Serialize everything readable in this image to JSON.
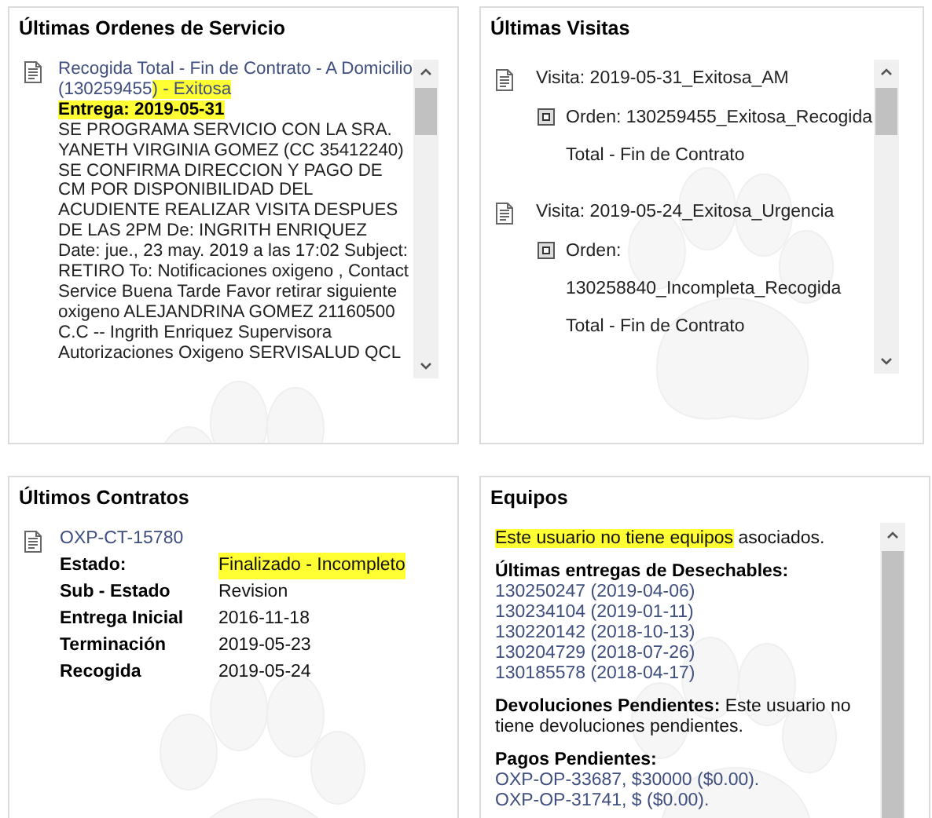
{
  "orders_panel": {
    "title": "Últimas Ordenes de Servicio",
    "orders": [
      {
        "title": [
          {
            "text": "Recogida Total - Fin de Contrato - A Domicilio (130259455",
            "highlighted": false
          },
          {
            "text": ") - Exitosa",
            "highlighted": true
          }
        ],
        "delivery": {
          "text": "Entrega: 2019-05-31",
          "highlighted": true
        },
        "notes": "SE PROGRAMA SERVICIO CON LA SRA. YANETH VIRGINIA GOMEZ (CC 35412240) SE CONFIRMA DIRECCION Y PAGO DE CM POR DISPONIBILIDAD DEL ACUDIENTE REALIZAR VISITA DESPUES DE LAS 2PM De: INGRITH ENRIQUEZ Date: jue., 23 may. 2019 a las 17:02 Subject: RETIRO To: Notificaciones oxigeno , Contact Service Buena Tarde Favor retirar siguiente oxigeno ALEJANDRINA GOMEZ 21160500 C.C -- Ingrith Enriquez Supervisora Autorizaciones Oxigeno SERVISALUD QCL"
      }
    ]
  },
  "visits_panel": {
    "title": "Últimas Visitas",
    "visits": [
      {
        "label": "Visita: 2019-05-31_Exitosa_AM",
        "orders": [
          "Orden: 130259455_Exitosa_Recogida Total - Fin de Contrato"
        ]
      },
      {
        "label": "Visita: 2019-05-24_Exitosa_Urgencia",
        "orders": [
          "Orden: 130258840_Incompleta_Recogida Total - Fin de Contrato"
        ]
      }
    ]
  },
  "contracts_panel": {
    "title": "Últimos Contratos",
    "contracts": [
      {
        "code": "OXP-CT-15780",
        "fields": [
          {
            "label": "Estado:",
            "value": "Finalizado - Incompleto",
            "highlighted": true
          },
          {
            "label": "Sub - Estado",
            "value": "Revision",
            "highlighted": false
          },
          {
            "label": "Entrega Inicial",
            "value": "2016-11-18",
            "highlighted": false
          },
          {
            "label": "Terminación",
            "value": "2019-05-23",
            "highlighted": false
          },
          {
            "label": "Recogida",
            "value": "2019-05-24",
            "highlighted": false
          }
        ]
      }
    ]
  },
  "equipment_panel": {
    "title": "Equipos",
    "message": [
      {
        "text": "Este usuario no tiene equipos",
        "highlighted": true
      },
      {
        "text": " asociados.",
        "highlighted": false
      }
    ],
    "deliveries_title": "Últimas entregas de Desechables:",
    "deliveries": [
      "130250247 (2019-04-06)",
      "130234104 (2019-01-11)",
      "130220142 (2018-10-13)",
      "130204729 (2018-07-26)",
      "130185578 (2018-04-17)"
    ],
    "returns": {
      "label": "Devoluciones Pendientes:",
      "text": "Este usuario no tiene devoluciones pendientes."
    },
    "payments_title": "Pagos Pendientes:",
    "payments": [
      "OXP-OP-33687, $30000 ($0.00).",
      "OXP-OP-31741, $ ($0.00)."
    ]
  }
}
